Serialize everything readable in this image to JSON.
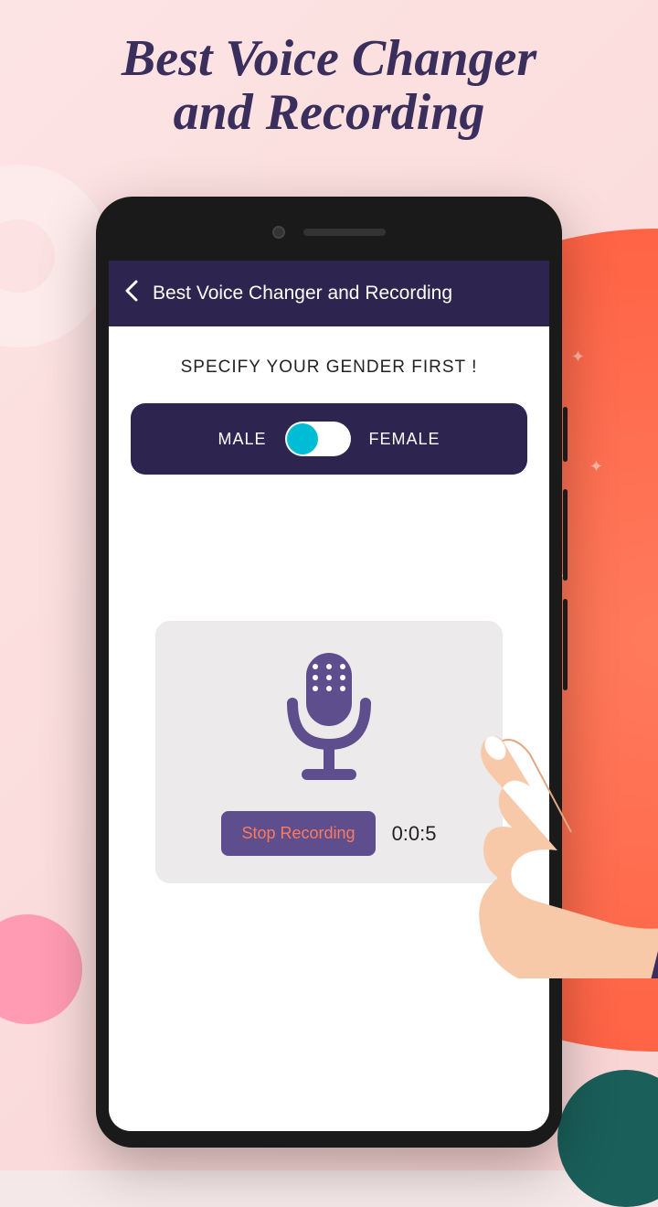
{
  "promo": {
    "title_line1": "Best Voice Changer",
    "title_line2": "and Recording"
  },
  "app": {
    "header": {
      "title": "Best Voice Changer and Recording"
    },
    "prompt": "SPECIFY YOUR GENDER FIRST !",
    "gender": {
      "male_label": "MALE",
      "female_label": "FEMALE",
      "selected": "male"
    },
    "recording": {
      "stop_label": "Stop Recording",
      "timer": "0:0:5"
    }
  }
}
